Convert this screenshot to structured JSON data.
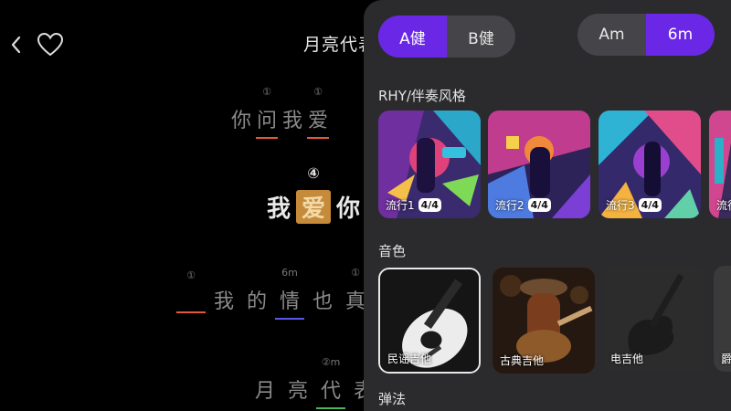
{
  "song": {
    "title": "月亮代表"
  },
  "icons": {
    "back": "chevron-left-icon",
    "favorite": "heart-icon"
  },
  "lyrics": [
    {
      "chars": [
        {
          "c": "你",
          "mark": ""
        },
        {
          "c": "问",
          "mark": "①",
          "line": "#e4593a"
        },
        {
          "c": "我",
          "mark": ""
        },
        {
          "c": "爱",
          "mark": "①",
          "line": "#e4593a"
        }
      ]
    },
    {
      "chars": [
        {
          "c": "我",
          "mark": ""
        },
        {
          "c": "爱",
          "mark": "④",
          "hl": true
        },
        {
          "c": "你",
          "mark": ""
        }
      ]
    },
    {
      "chars": [
        {
          "c": "",
          "mark": "①",
          "line": "#e4593a"
        },
        {
          "c": "我",
          "mark": ""
        },
        {
          "c": "的",
          "mark": ""
        },
        {
          "c": "情",
          "mark": "6m",
          "line": "#5b55e8"
        },
        {
          "c": "也",
          "mark": ""
        },
        {
          "c": "真",
          "mark": "①"
        }
      ]
    },
    {
      "chars": [
        {
          "c": "月",
          "mark": ""
        },
        {
          "c": "亮",
          "mark": ""
        },
        {
          "c": "代",
          "mark": "②m",
          "line": "#4bb55a"
        },
        {
          "c": "表",
          "mark": ""
        }
      ]
    }
  ],
  "panel": {
    "key": {
      "options": [
        "A健",
        "B健"
      ],
      "selected": 0
    },
    "chord": {
      "options": [
        "Am",
        "6m"
      ],
      "selected": 1
    },
    "rhythm_label": "RHY/伴奏风格",
    "rhythms": [
      {
        "name": "流行1",
        "meter": "4/4"
      },
      {
        "name": "流行2",
        "meter": "4/4"
      },
      {
        "name": "流行3",
        "meter": "4/4"
      },
      {
        "name": "流行",
        "meter": ""
      }
    ],
    "tone_label": "音色",
    "tones": [
      {
        "name": "民谣吉他",
        "selected": true
      },
      {
        "name": "古典吉他",
        "selected": false
      },
      {
        "name": "电吉他",
        "selected": false
      },
      {
        "name": "爵",
        "selected": false
      }
    ],
    "play_label": "弹法"
  },
  "colors": {
    "accent": "#6a28e6",
    "panel_bg": "#2b2b2e",
    "highlight": "#c58b3b"
  }
}
